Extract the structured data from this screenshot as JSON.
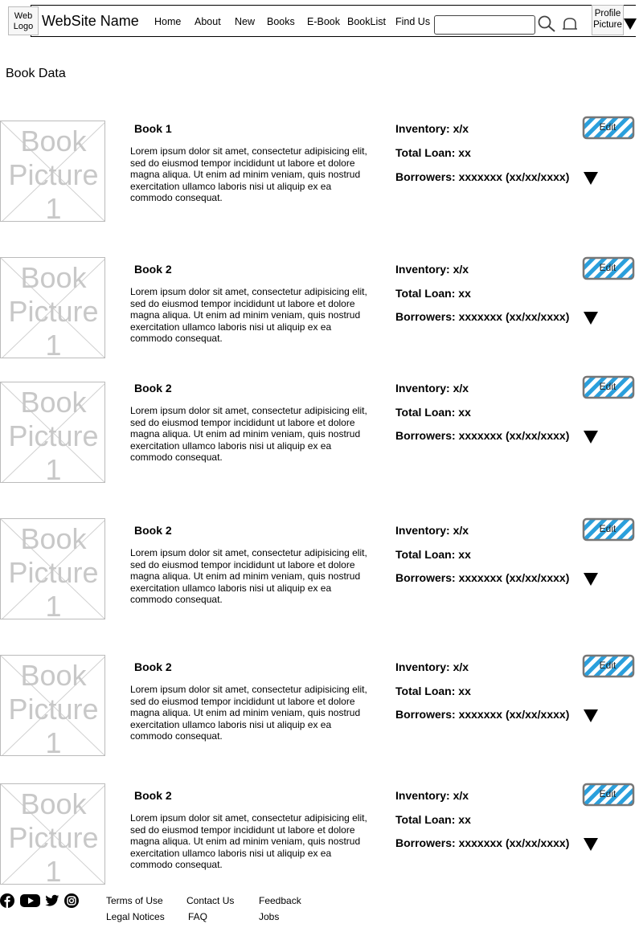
{
  "header": {
    "logo_label": "Web Logo",
    "site_name": "WebSite Name",
    "nav": [
      {
        "label": "Home"
      },
      {
        "label": "About"
      },
      {
        "label": "New"
      },
      {
        "label": "Books"
      },
      {
        "label": "E-Book"
      },
      {
        "label": "BookList"
      },
      {
        "label": "Find Us"
      }
    ],
    "search": {
      "value": "",
      "placeholder": ""
    },
    "profile_label": "Profile Picture"
  },
  "page": {
    "title": "Book Data"
  },
  "books": [
    {
      "picture_text": "Book Picture 1",
      "title": "Book 1",
      "description": "Lorem ipsum dolor sit amet, consectetur adipisicing elit, sed do eiusmod tempor incididunt ut labore et dolore magna aliqua. Ut enim ad minim veniam, quis nostrud exercitation ullamco laboris nisi ut aliquip ex ea commodo consequat.",
      "inventory": "Inventory: x/x",
      "total_loan": "Total Loan: xx",
      "borrowers": "Borrowers: xxxxxxx (xx/xx/xxxx)",
      "edit_label": "Edit"
    },
    {
      "picture_text": "Book Picture 1",
      "title": "Book 2",
      "description": "Lorem ipsum dolor sit amet, consectetur adipisicing elit, sed do eiusmod tempor incididunt ut labore et dolore magna aliqua. Ut enim ad minim veniam, quis nostrud exercitation ullamco laboris nisi ut aliquip ex ea commodo consequat.",
      "inventory": "Inventory: x/x",
      "total_loan": "Total Loan: xx",
      "borrowers": "Borrowers: xxxxxxx (xx/xx/xxxx)",
      "edit_label": "Edit"
    },
    {
      "picture_text": "Book Picture 1",
      "title": "Book 2",
      "description": "Lorem ipsum dolor sit amet, consectetur adipisicing elit, sed do eiusmod tempor incididunt ut labore et dolore magna aliqua. Ut enim ad minim veniam, quis nostrud exercitation ullamco laboris nisi ut aliquip ex ea commodo consequat.",
      "inventory": "Inventory: x/x",
      "total_loan": "Total Loan: xx",
      "borrowers": "Borrowers: xxxxxxx (xx/xx/xxxx)",
      "edit_label": "Edit"
    },
    {
      "picture_text": "Book Picture 1",
      "title": "Book 2",
      "description": "Lorem ipsum dolor sit amet, consectetur adipisicing elit, sed do eiusmod tempor incididunt ut labore et dolore magna aliqua. Ut enim ad minim veniam, quis nostrud exercitation ullamco laboris nisi ut aliquip ex ea commodo consequat.",
      "inventory": "Inventory: x/x",
      "total_loan": "Total Loan: xx",
      "borrowers": "Borrowers: xxxxxxx (xx/xx/xxxx)",
      "edit_label": "Edit"
    },
    {
      "picture_text": "Book Picture 1",
      "title": "Book 2",
      "description": "Lorem ipsum dolor sit amet, consectetur adipisicing elit, sed do eiusmod tempor incididunt ut labore et dolore magna aliqua. Ut enim ad minim veniam, quis nostrud exercitation ullamco laboris nisi ut aliquip ex ea commodo consequat.",
      "inventory": "Inventory: x/x",
      "total_loan": "Total Loan: xx",
      "borrowers": "Borrowers: xxxxxxx (xx/xx/xxxx)",
      "edit_label": "Edit"
    },
    {
      "picture_text": "Book Picture 1",
      "title": "Book 2",
      "description": "Lorem ipsum dolor sit amet, consectetur adipisicing elit, sed do eiusmod tempor incididunt ut labore et dolore magna aliqua. Ut enim ad minim veniam, quis nostrud exercitation ullamco laboris nisi ut aliquip ex ea commodo consequat.",
      "inventory": "Inventory: x/x",
      "total_loan": "Total Loan: xx",
      "borrowers": "Borrowers: xxxxxxx (xx/xx/xxxx)",
      "edit_label": "Edit"
    }
  ],
  "footer": {
    "social_icons": [
      "facebook-icon",
      "youtube-icon",
      "twitter-icon",
      "instagram-icon"
    ],
    "links": [
      {
        "label": "Terms of Use"
      },
      {
        "label": "Contact Us"
      },
      {
        "label": "Feedback"
      },
      {
        "label": "Legal Notices"
      },
      {
        "label": "FAQ"
      },
      {
        "label": "Jobs"
      }
    ]
  },
  "colors": {
    "edit_stripe": "#2a9fdc",
    "edit_border": "#777777",
    "placeholder_gray": "#c8c8c8"
  }
}
